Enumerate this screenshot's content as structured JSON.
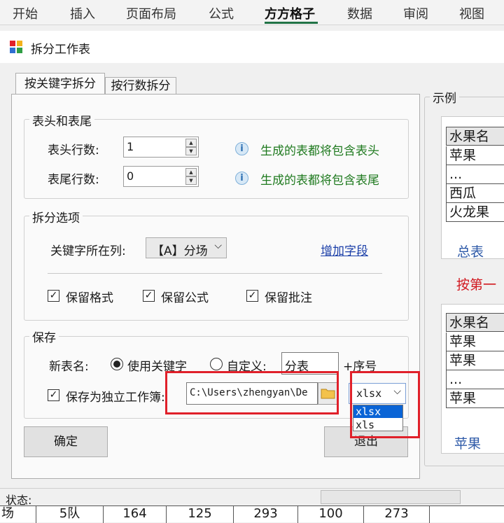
{
  "ribbon": {
    "tabs": [
      "开始",
      "插入",
      "页面布局",
      "公式",
      "方方格子",
      "数据",
      "审阅",
      "视图"
    ],
    "active": "方方格子"
  },
  "dialog": {
    "title": "拆分工作表"
  },
  "tabs": [
    "按关键字拆分",
    "按行数拆分"
  ],
  "header_footer": {
    "group_label": "表头和表尾",
    "header_rows_label": "表头行数:",
    "header_rows_value": "1",
    "header_hint": "生成的表都将包含表头",
    "footer_rows_label": "表尾行数:",
    "footer_rows_value": "0",
    "footer_hint": "生成的表都将包含表尾"
  },
  "split_options": {
    "group_label": "拆分选项",
    "key_column_label": "关键字所在列:",
    "key_column_value": "【A】分场",
    "add_field_link": "增加字段",
    "keep_format": "保留格式",
    "keep_formula": "保留公式",
    "keep_comment": "保留批注"
  },
  "save": {
    "group_label": "保存",
    "new_sheet_name_label": "新表名:",
    "use_keyword": "使用关键字",
    "custom": "自定义:",
    "custom_value": "分表",
    "seq_suffix": "+序号",
    "save_as_workbook": "保存为独立工作簿:",
    "path_value": "C:\\Users\\zhengyan\\De",
    "format_selected": "xlsx",
    "format_options": [
      "xlsx",
      "xls"
    ]
  },
  "buttons": {
    "ok": "确定",
    "exit": "退出"
  },
  "example": {
    "label": "示例",
    "sheet1": {
      "rows": [
        "水果名",
        "苹果",
        "...",
        "西瓜",
        "火龙果"
      ],
      "tab": "总表"
    },
    "caption": "按第一",
    "sheet2": {
      "rows": [
        "水果名",
        "苹果",
        "苹果",
        "...",
        "苹果"
      ],
      "tab": "苹果"
    }
  },
  "status": {
    "label": "状态:"
  },
  "grid_row": [
    "场",
    "5队",
    "164",
    "125",
    "293",
    "100",
    "273"
  ],
  "colors": {
    "accent": "#217346",
    "highlight": "#e0202a",
    "hint": "#1f7a1f",
    "link": "#1a3ea8"
  }
}
